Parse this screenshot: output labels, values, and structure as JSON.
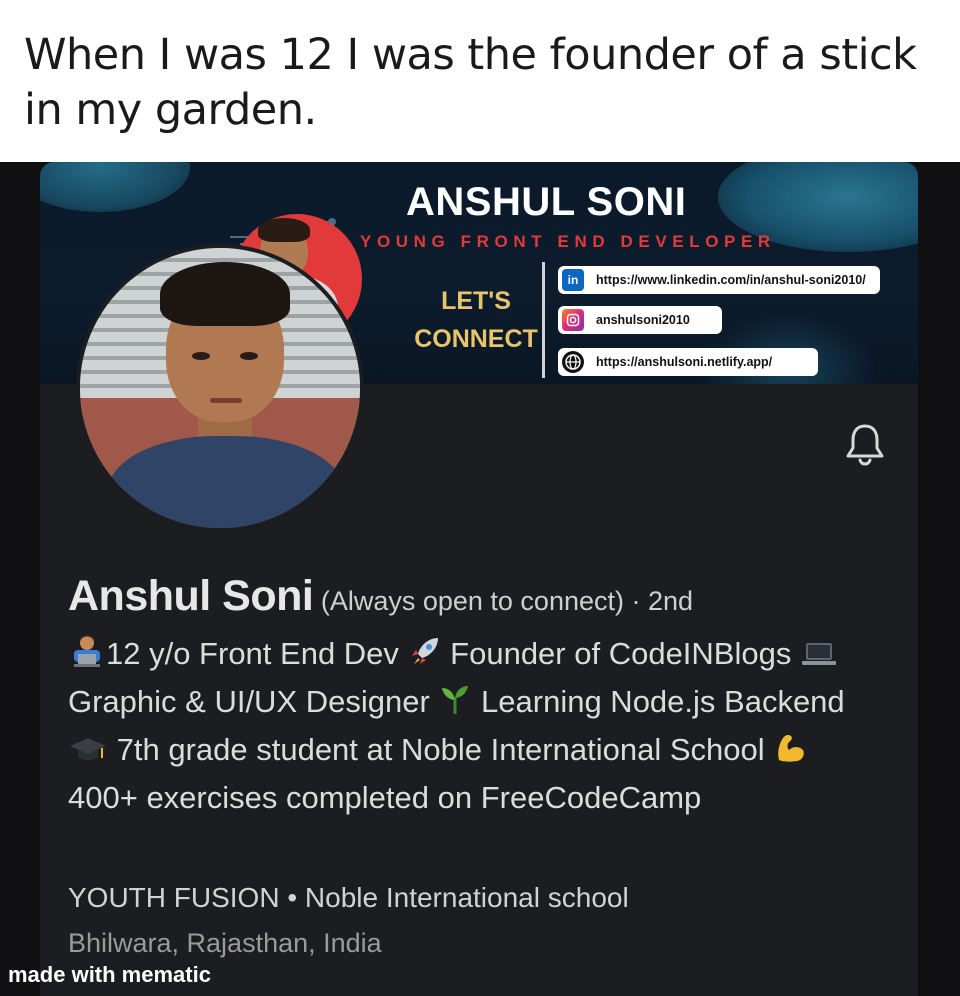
{
  "caption": "When I was 12 I was the founder of a stick in my garden.",
  "banner": {
    "title": "ANSHUL SONI",
    "subtitle": "YOUNG FRONT END DEVELOPER",
    "lets_connect_line1": "LET'S",
    "lets_connect_line2": "CONNECT",
    "links": [
      {
        "icon": "linkedin-icon",
        "text": "https://www.linkedin.com/in/anshul-soni2010/"
      },
      {
        "icon": "instagram-icon",
        "text": "anshulsoni2010"
      },
      {
        "icon": "globe-icon",
        "text": "https://anshulsoni.netlify.app/"
      }
    ]
  },
  "profile": {
    "name": "Anshul Soni",
    "status": " (Always open to connect) · 2nd",
    "headline_parts": [
      "12 y/o Front End Dev ",
      " Founder of CodeINBlogs ",
      "Graphic & UI/UX Designer ",
      " Learning Node.js Backend ",
      " 7th grade student at Noble International School ",
      " 400+ exercises completed on FreeCodeCamp"
    ],
    "org_line": "YOUTH FUSION • Noble International school",
    "location": "Bhilwara, Rajasthan, India"
  },
  "colors": {
    "card_bg": "#1c1d20",
    "banner_accent": "#e03a3a",
    "connect_gold": "#e8c56a"
  },
  "watermark": "made with mematic"
}
